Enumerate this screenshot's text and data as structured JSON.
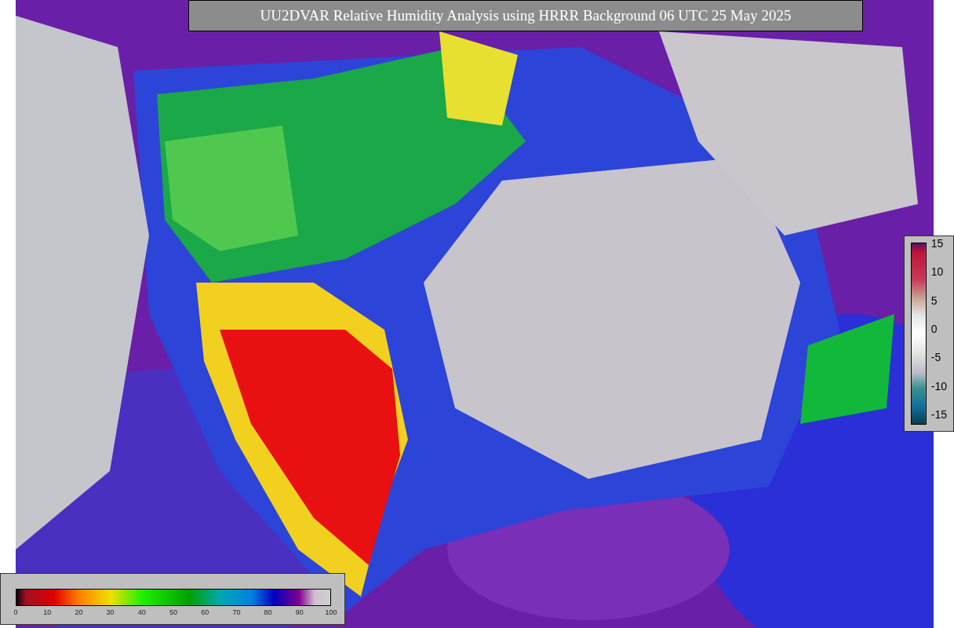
{
  "title": "UU2DVAR Relative Humidity Analysis using HRRR Background 06 UTC 25 May 2025",
  "difference_legend": {
    "ticks": [
      "15",
      "10",
      "5",
      "0",
      "-5",
      "-10",
      "-15"
    ]
  },
  "humidity_legend": {
    "ticks": [
      "0",
      "10",
      "20",
      "30",
      "40",
      "50",
      "60",
      "70",
      "80",
      "90",
      "100"
    ]
  }
}
